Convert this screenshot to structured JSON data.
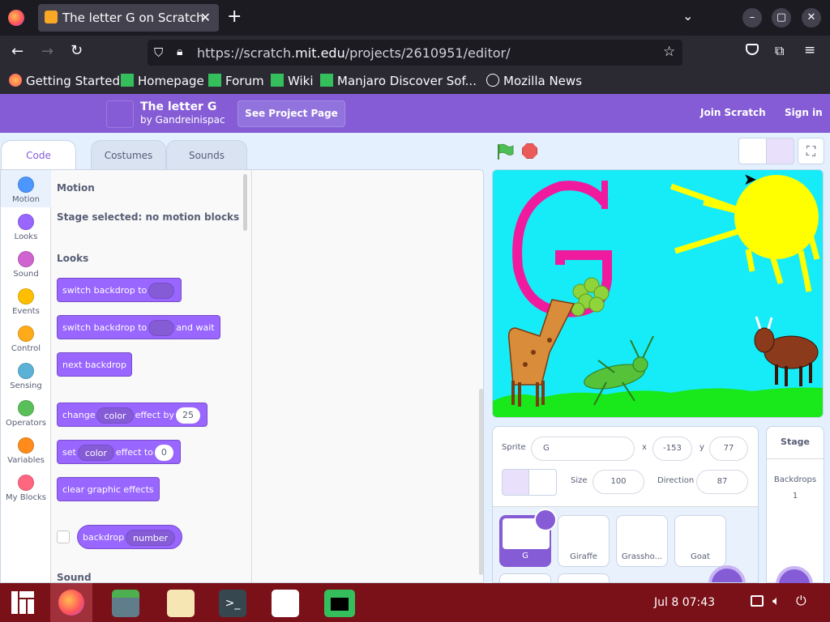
{
  "browser": {
    "tab_title": "The letter G on Scratch",
    "url_prefix": "https://scratch.",
    "url_domain": "mit.edu",
    "url_path": "/projects/2610951/editor/",
    "bookmarks": [
      "Getting Started",
      "Homepage",
      "Forum",
      "Wiki",
      "Manjaro Discover Sof...",
      "Mozilla News"
    ]
  },
  "scratch": {
    "project_title": "The letter G",
    "project_author": "by Gandreinispac",
    "see_project_page": "See Project Page",
    "join": "Join Scratch",
    "sign_in": "Sign in",
    "tabs": [
      "Code",
      "Costumes",
      "Sounds"
    ],
    "categories": [
      {
        "label": "Motion",
        "color": "#4c97ff"
      },
      {
        "label": "Looks",
        "color": "#9966ff"
      },
      {
        "label": "Sound",
        "color": "#cf63cf"
      },
      {
        "label": "Events",
        "color": "#ffbf00"
      },
      {
        "label": "Control",
        "color": "#ffab19"
      },
      {
        "label": "Sensing",
        "color": "#5cb1d6"
      },
      {
        "label": "Operators",
        "color": "#59c059"
      },
      {
        "label": "Variables",
        "color": "#ff8c1a"
      },
      {
        "label": "My Blocks",
        "color": "#ff6680"
      }
    ],
    "palette": {
      "motion_heading": "Motion",
      "motion_note": "Stage selected: no motion blocks",
      "looks_heading": "Looks",
      "sound_heading": "Sound",
      "switch_backdrop": "switch backdrop to",
      "switch_backdrop_wait_a": "switch backdrop to",
      "switch_backdrop_wait_b": "and wait",
      "next_backdrop": "next backdrop",
      "change_a": "change",
      "change_effect": "color",
      "change_b": "effect by",
      "change_value": "25",
      "set_a": "set",
      "set_effect": "color",
      "set_b": "effect to",
      "set_value": "0",
      "clear_effects": "clear graphic effects",
      "backdrop_reporter": "backdrop",
      "backdrop_option": "number"
    },
    "sprite_info": {
      "sprite_label": "Sprite",
      "sprite_name": "G",
      "x_label": "x",
      "x_value": "-153",
      "y_label": "y",
      "y_value": "77",
      "size_label": "Size",
      "size_value": "100",
      "direction_label": "Direction",
      "direction_value": "87"
    },
    "sprites": [
      "G",
      "Giraffe",
      "Grassho...",
      "Goat"
    ],
    "stage_panel": {
      "title": "Stage",
      "backdrops_label": "Backdrops",
      "backdrops_count": "1"
    }
  },
  "taskbar": {
    "clock": "Jul 8  07:43"
  }
}
